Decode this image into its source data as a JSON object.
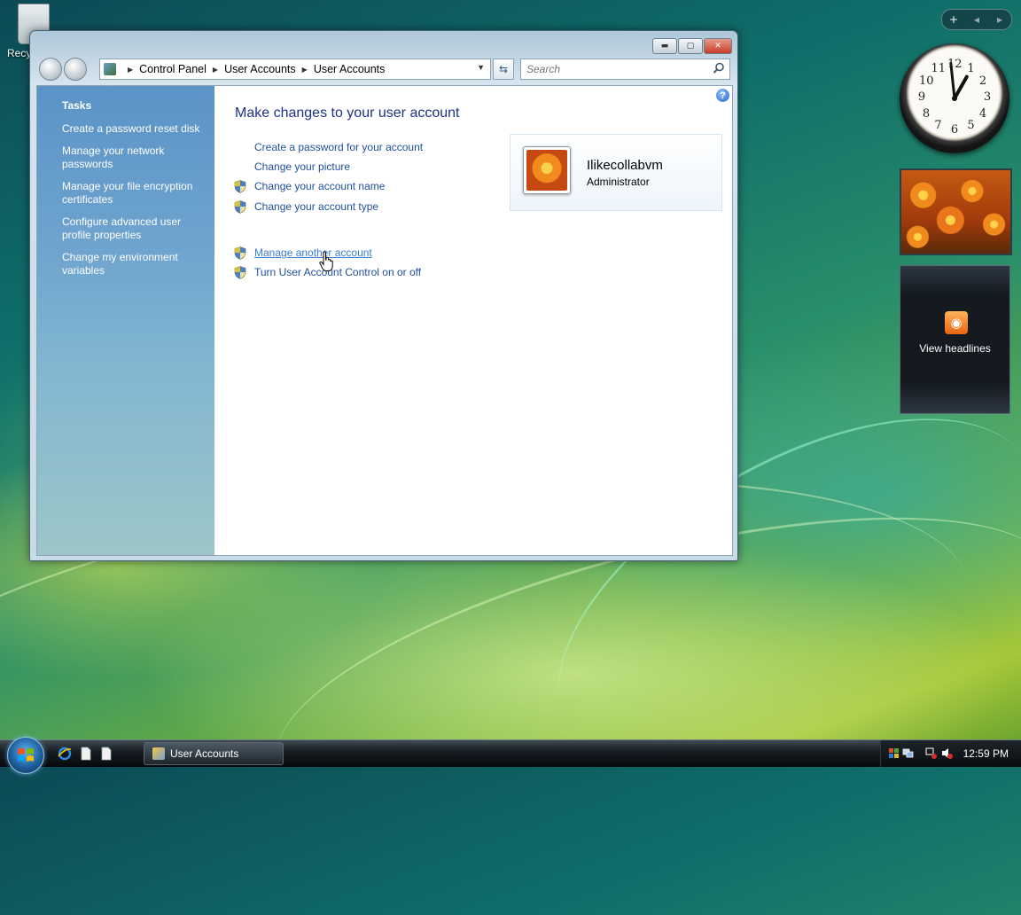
{
  "desktop": {
    "recycle_bin_label": "Recy"
  },
  "window": {
    "title": "User Accounts",
    "controls": {
      "minimize": "▬",
      "maximize": "▢",
      "close": "✕"
    },
    "breadcrumb": [
      "Control Panel",
      "User Accounts",
      "User Accounts"
    ],
    "search_placeholder": "Search",
    "help_label": "?"
  },
  "tasks": {
    "heading": "Tasks",
    "items": [
      "Create a password reset disk",
      "Manage your network passwords",
      "Manage your file encryption certificates",
      "Configure advanced user profile properties",
      "Change my environment variables"
    ]
  },
  "main": {
    "title": "Make changes to your user account",
    "links": [
      {
        "label": "Create a password for your account",
        "shield": false
      },
      {
        "label": "Change your picture",
        "shield": false
      },
      {
        "label": "Change your account name",
        "shield": true
      },
      {
        "label": "Change your account type",
        "shield": true
      }
    ],
    "links2": [
      {
        "label": "Manage another account",
        "shield": true,
        "hovered": true
      },
      {
        "label": "Turn User Account Control on or off",
        "shield": true
      }
    ]
  },
  "user": {
    "name": "Ilikecollabvm",
    "role": "Administrator"
  },
  "gadgets": {
    "controls": [
      "+",
      "◂",
      "▸"
    ],
    "clock_numbers": [
      "12",
      "1",
      "2",
      "3",
      "4",
      "5",
      "6",
      "7",
      "8",
      "9",
      "10",
      "11"
    ],
    "clock_time": {
      "hours": 12,
      "minutes": 59
    },
    "feed_label": "View headlines"
  },
  "taskbar": {
    "active_window": "User Accounts",
    "time": "12:59 PM"
  },
  "colors": {
    "link": "#1f4f9e",
    "title": "#1e3287",
    "tasks_pane": "#6fa4ce"
  }
}
